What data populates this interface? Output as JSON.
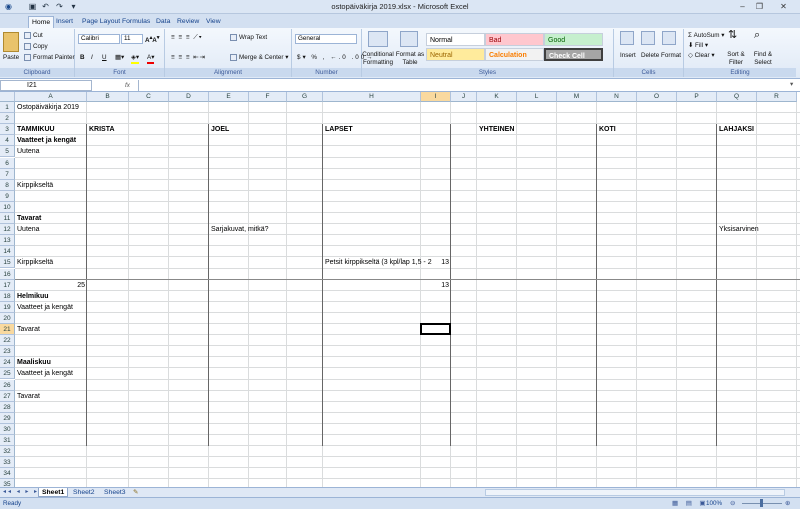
{
  "window": {
    "title": "ostopäiväkirja 2019.xlsx - Microsoft Excel"
  },
  "ribbon_tabs": [
    "Home",
    "Insert",
    "Page Layout",
    "Formulas",
    "Data",
    "Review",
    "View"
  ],
  "ribbon": {
    "clipboard": {
      "label": "Clipboard",
      "paste": "Paste",
      "cut": "Cut",
      "copy": "Copy",
      "format_painter": "Format Painter"
    },
    "font": {
      "label": "Font",
      "font_name": "Calibri",
      "font_size": "11",
      "bold": "B",
      "italic": "I",
      "underline": "U"
    },
    "alignment": {
      "label": "Alignment",
      "wrap_text": "Wrap Text",
      "merge_center": "Merge & Center"
    },
    "number": {
      "label": "Number",
      "format": "General"
    },
    "styles": {
      "label": "Styles",
      "conditional": "Conditional Formatting",
      "format_table": "Format as Table",
      "normal": "Normal",
      "bad": "Bad",
      "good": "Good",
      "neutral": "Neutral",
      "calculation": "Calculation",
      "check_cell": "Check Cell"
    },
    "cells": {
      "label": "Cells",
      "insert": "Insert",
      "delete": "Delete",
      "format": "Format"
    },
    "editing": {
      "label": "Editing",
      "autosum": "AutoSum",
      "fill": "Fill",
      "clear": "Clear",
      "sort_filter": "Sort & Filter",
      "find_select": "Find & Select"
    }
  },
  "formula_bar": {
    "name_box": "I21",
    "fx": "fx",
    "content": ""
  },
  "columns": [
    "A",
    "B",
    "C",
    "D",
    "E",
    "F",
    "G",
    "H",
    "I",
    "J",
    "K",
    "L",
    "M",
    "N",
    "O",
    "P",
    "Q",
    "R"
  ],
  "selected_cell": {
    "col": "I",
    "row": 21
  },
  "cells": [
    {
      "r": 1,
      "c": "A",
      "v": "Ostopäiväkirja 2019"
    },
    {
      "r": 3,
      "c": "A",
      "v": "TAMMIKUU",
      "b": true
    },
    {
      "r": 3,
      "c": "B",
      "v": "KRISTA",
      "b": true
    },
    {
      "r": 3,
      "c": "E",
      "v": "JOEL",
      "b": true
    },
    {
      "r": 3,
      "c": "H",
      "v": "LAPSET",
      "b": true
    },
    {
      "r": 3,
      "c": "K",
      "v": "YHTEINEN",
      "b": true
    },
    {
      "r": 3,
      "c": "N",
      "v": "KOTI",
      "b": true
    },
    {
      "r": 3,
      "c": "Q",
      "v": "LAHJAKSI",
      "b": true
    },
    {
      "r": 4,
      "c": "A",
      "v": "Vaatteet ja kengät",
      "b": true
    },
    {
      "r": 5,
      "c": "A",
      "v": "Uutena"
    },
    {
      "r": 8,
      "c": "A",
      "v": "Kirppikseltä"
    },
    {
      "r": 11,
      "c": "A",
      "v": "Tavarat",
      "b": true
    },
    {
      "r": 12,
      "c": "A",
      "v": "Uutena"
    },
    {
      "r": 12,
      "c": "E",
      "v": "Sarjakuvat, mitkä?"
    },
    {
      "r": 12,
      "c": "Q",
      "v": "Yksisarvinen"
    },
    {
      "r": 15,
      "c": "A",
      "v": "Kirppikseltä"
    },
    {
      "r": 15,
      "c": "H",
      "v": "Petsit kirppikseltä (3 kpl/lap 1,5 - 2"
    },
    {
      "r": 15,
      "c": "I",
      "v": "13",
      "right": true
    },
    {
      "r": 17,
      "c": "A",
      "v": "25",
      "right": true
    },
    {
      "r": 17,
      "c": "I",
      "v": "13",
      "right": true
    },
    {
      "r": 18,
      "c": "A",
      "v": "Helmikuu",
      "b": true
    },
    {
      "r": 19,
      "c": "A",
      "v": "Vaatteet ja kengät"
    },
    {
      "r": 21,
      "c": "A",
      "v": "Tavarat"
    },
    {
      "r": 24,
      "c": "A",
      "v": "Maaliskuu",
      "b": true
    },
    {
      "r": 25,
      "c": "A",
      "v": "Vaatteet ja kengät"
    },
    {
      "r": 27,
      "c": "A",
      "v": "Tavarat"
    }
  ],
  "sheets": [
    "Sheet1",
    "Sheet2",
    "Sheet3"
  ],
  "active_sheet": "Sheet1",
  "status": {
    "ready": "Ready",
    "zoom": "100%"
  }
}
